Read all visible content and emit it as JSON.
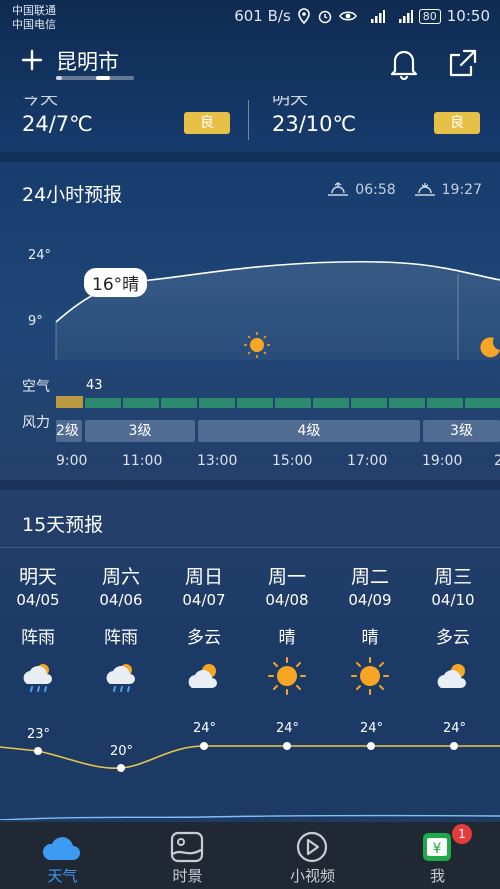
{
  "status_bar": {
    "carrier_1": "中国联通",
    "carrier_2": "中国电信",
    "speed": "601 B/s",
    "battery": "80",
    "time": "10:50"
  },
  "header": {
    "city": "昆明市",
    "add_icon": "plus-icon",
    "bell_icon": "bell-icon",
    "share_icon": "share-icon"
  },
  "today_row": {
    "left": {
      "temp": "24/7℃",
      "air": "良"
    },
    "right": {
      "temp": "23/10℃",
      "air": "良"
    }
  },
  "hourly": {
    "title": "24小时预报",
    "sunrise": "06:58",
    "sunset": "19:27",
    "y_max_label": "24°",
    "y_min_label": "9°",
    "current_bubble": "16°晴",
    "air_label": "空气",
    "aqi_value": "43",
    "wind_label": "风力",
    "wind_segments": [
      "2级",
      "3级",
      "4级",
      "3级"
    ],
    "times": [
      "9:00",
      "11:00",
      "13:00",
      "15:00",
      "17:00",
      "19:00",
      "2"
    ]
  },
  "forecast15": {
    "title": "15天预报",
    "days": [
      {
        "name": "明天",
        "date": "04/05",
        "cond": "阵雨",
        "icon": "rain-cloud-icon",
        "high": "23°"
      },
      {
        "name": "周六",
        "date": "04/06",
        "cond": "阵雨",
        "icon": "rain-cloud-icon",
        "high": "20°"
      },
      {
        "name": "周日",
        "date": "04/07",
        "cond": "多云",
        "icon": "cloudy-icon",
        "high": "24°"
      },
      {
        "name": "周一",
        "date": "04/08",
        "cond": "晴",
        "icon": "sun-icon",
        "high": "24°"
      },
      {
        "name": "周二",
        "date": "04/09",
        "cond": "晴",
        "icon": "sun-icon",
        "high": "24°"
      },
      {
        "name": "周三",
        "date": "04/10",
        "cond": "多云",
        "icon": "cloudy-icon",
        "high": "24°"
      }
    ]
  },
  "tabbar": {
    "tabs": [
      {
        "label": "天气",
        "icon": "cloud-icon"
      },
      {
        "label": "时景",
        "icon": "photo-icon"
      },
      {
        "label": "小视频",
        "icon": "play-icon"
      },
      {
        "label": "我",
        "icon": "wallet-icon"
      }
    ],
    "badge": "1"
  },
  "colors": {
    "accent": "#3d9bf2",
    "aqi_good": "#e7c048",
    "sun": "#f6a623",
    "temp_line": "#e8c84a"
  }
}
